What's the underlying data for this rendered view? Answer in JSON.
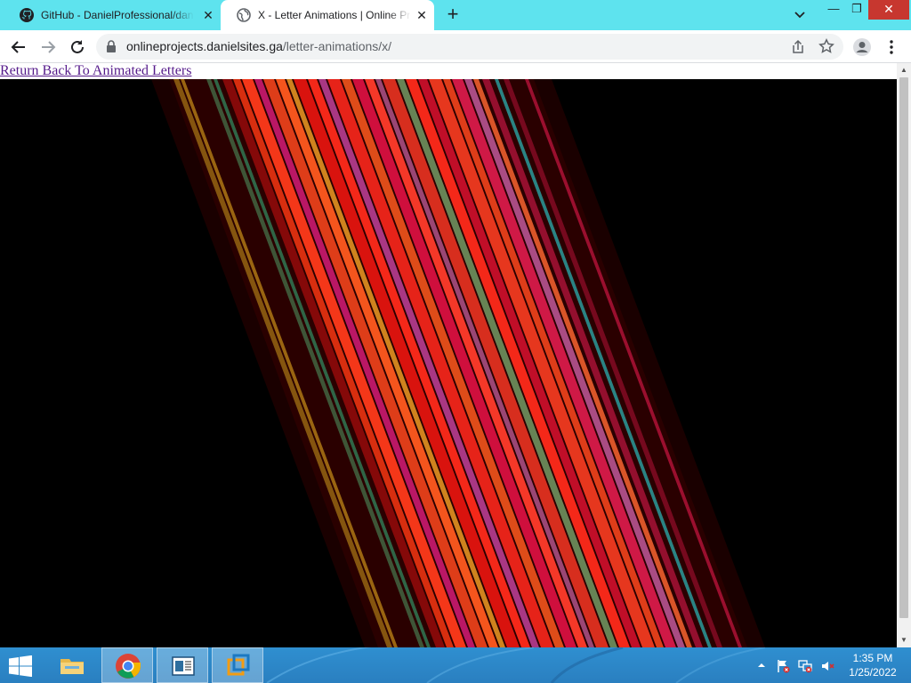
{
  "browser": {
    "tabs": [
      {
        "title": "GitHub - DanielProfessional/daniel",
        "favicon": "github-icon",
        "active": false
      },
      {
        "title": "X - Letter Animations | Online Projects",
        "favicon": "globe-icon",
        "active": true
      }
    ],
    "new_tab": "+",
    "window_controls": {
      "minimize": "—",
      "maximize": "❐",
      "close": "✕"
    },
    "address": {
      "host": "onlineprojects.danielsites.ga",
      "path": "/letter-animations/x/"
    }
  },
  "page": {
    "back_link": "Return Back To Animated Letters"
  },
  "taskbar": {
    "apps": [
      "file-explorer",
      "chrome",
      "document-viewer",
      "vmware"
    ],
    "clock": {
      "time": "1:35 PM",
      "date": "1/25/2022"
    }
  },
  "colors": {
    "tabstrip": "#5ee3ee",
    "link_visited": "#551a8b",
    "taskbar": "#2f8fd0",
    "canvas": "#000000"
  }
}
